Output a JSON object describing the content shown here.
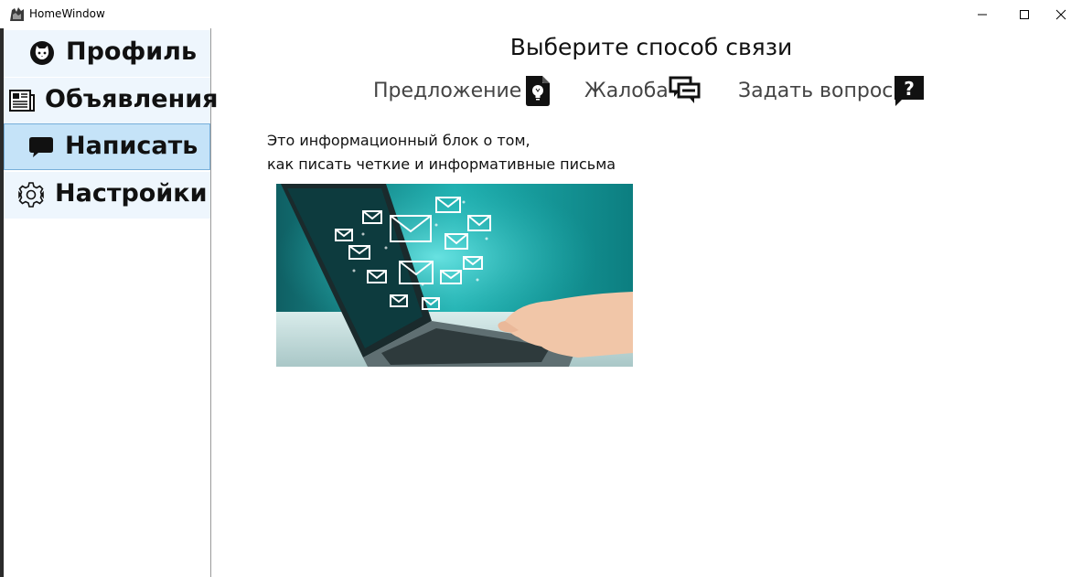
{
  "window": {
    "title": "HomeWindow"
  },
  "sidebar": {
    "items": [
      {
        "label": "Профиль",
        "icon": "cat-face-icon",
        "active": false
      },
      {
        "label": "Объявления",
        "icon": "newspaper-icon",
        "active": false
      },
      {
        "label": "Написать",
        "icon": "speech-bubble-icon",
        "active": true
      },
      {
        "label": "Настройки",
        "icon": "gear-icon",
        "active": false
      }
    ]
  },
  "main": {
    "title": "Выберите способ связи",
    "options": [
      {
        "label": "Предложение",
        "icon": "lightbulb-document-icon"
      },
      {
        "label": "Жалоба",
        "icon": "chat-bubbles-icon"
      },
      {
        "label": "Задать вопрос",
        "icon": "question-bubble-icon"
      }
    ],
    "info": {
      "line1": "Это информационный блок о том,",
      "line2": "как писать четкие и информативные письма"
    },
    "image": {
      "icon": "laptop-email-illustration"
    }
  },
  "colors": {
    "nav_bg": "#eef6fd",
    "nav_active_bg": "#c5e3f8",
    "nav_active_border": "#78afd9",
    "accent_teal": "#1fb0b0"
  }
}
